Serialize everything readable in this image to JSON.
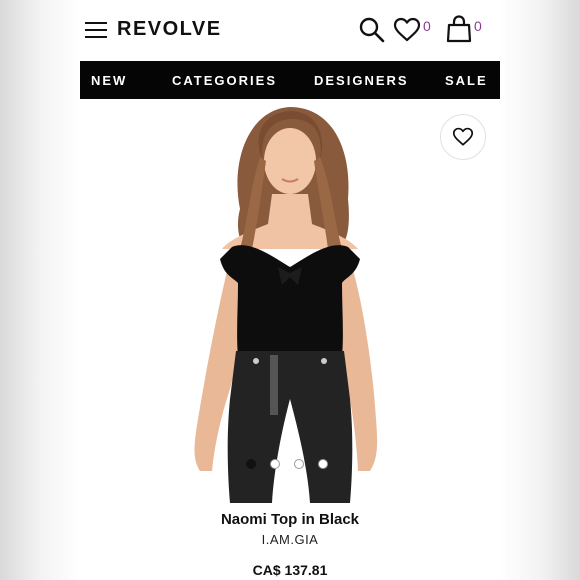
{
  "header": {
    "logo": "REVOLVE",
    "wishlist_count": "0",
    "bag_count": "0"
  },
  "nav": {
    "items": [
      "NEW",
      "CATEGORIES",
      "DESIGNERS",
      "SALE"
    ]
  },
  "product": {
    "name": "Naomi Top in Black",
    "brand": "I.AM.GIA",
    "price": "CA$ 137.81",
    "image_count": 4,
    "active_image": 1
  },
  "colors": {
    "nav_bg": "#050505",
    "count_accent": "#8a3b8f"
  }
}
